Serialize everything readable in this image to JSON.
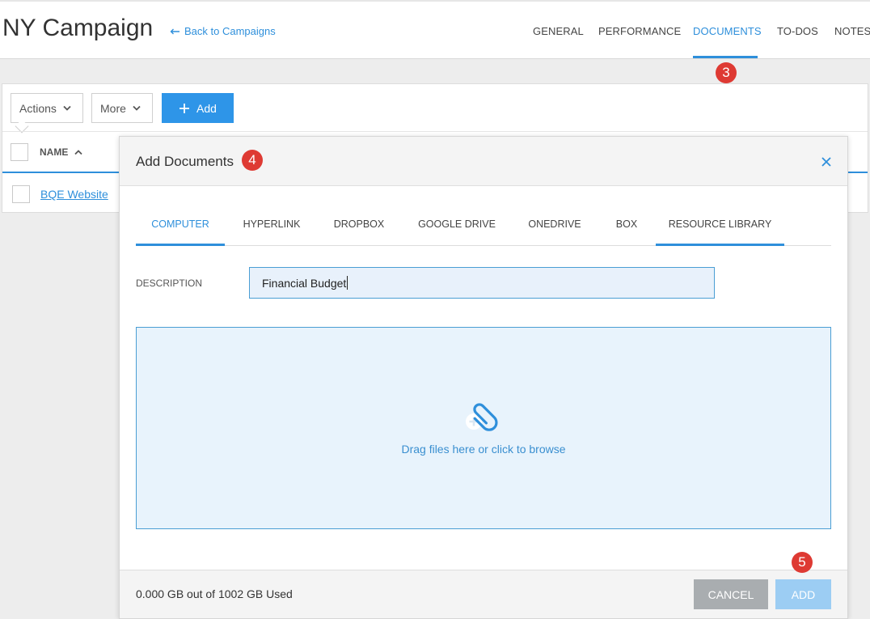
{
  "header": {
    "title": "NY Campaign",
    "back_link": "Back to Campaigns",
    "tabs": [
      {
        "label": "GENERAL",
        "active": false
      },
      {
        "label": "PERFORMANCE",
        "active": false
      },
      {
        "label": "DOCUMENTS",
        "active": true
      },
      {
        "label": "TO-DOs",
        "active": false
      },
      {
        "label": "NOTES",
        "active": false
      }
    ]
  },
  "badges": {
    "documents_tab": "3",
    "modal_title": "4",
    "add_button": "5"
  },
  "list": {
    "actions_label": "Actions",
    "more_label": "More",
    "add_label": "Add",
    "column_name": "NAME",
    "rows": [
      {
        "name": "BQE Website"
      }
    ]
  },
  "modal": {
    "title": "Add Documents",
    "source_tabs": [
      {
        "label": "COMPUTER",
        "active": true
      },
      {
        "label": "HYPERLINK",
        "active": false
      },
      {
        "label": "DROPBOX",
        "active": false
      },
      {
        "label": "GOOGLE DRIVE",
        "active": false
      },
      {
        "label": "ONEDRIVE",
        "active": false
      },
      {
        "label": "BOX",
        "active": false
      },
      {
        "label": "RESOURCE LIBRARY",
        "active": false
      }
    ],
    "description_label": "DESCRIPTION",
    "description_value": "Financial Budget",
    "dropzone_text": "Drag files here or click to browse",
    "storage_text": "0.000 GB out of 1002 GB Used",
    "cancel_label": "CANCEL",
    "add_label": "ADD"
  },
  "colors": {
    "accent": "#2e8fdb",
    "badge": "#de3a33",
    "cancel": "#a9adb0",
    "add_disabled": "#9ccdf3"
  },
  "icons": [
    "arrow-left-icon",
    "chevron-down-icon",
    "plus-icon",
    "chevron-up-icon",
    "close-icon",
    "paperclip-add-icon"
  ]
}
